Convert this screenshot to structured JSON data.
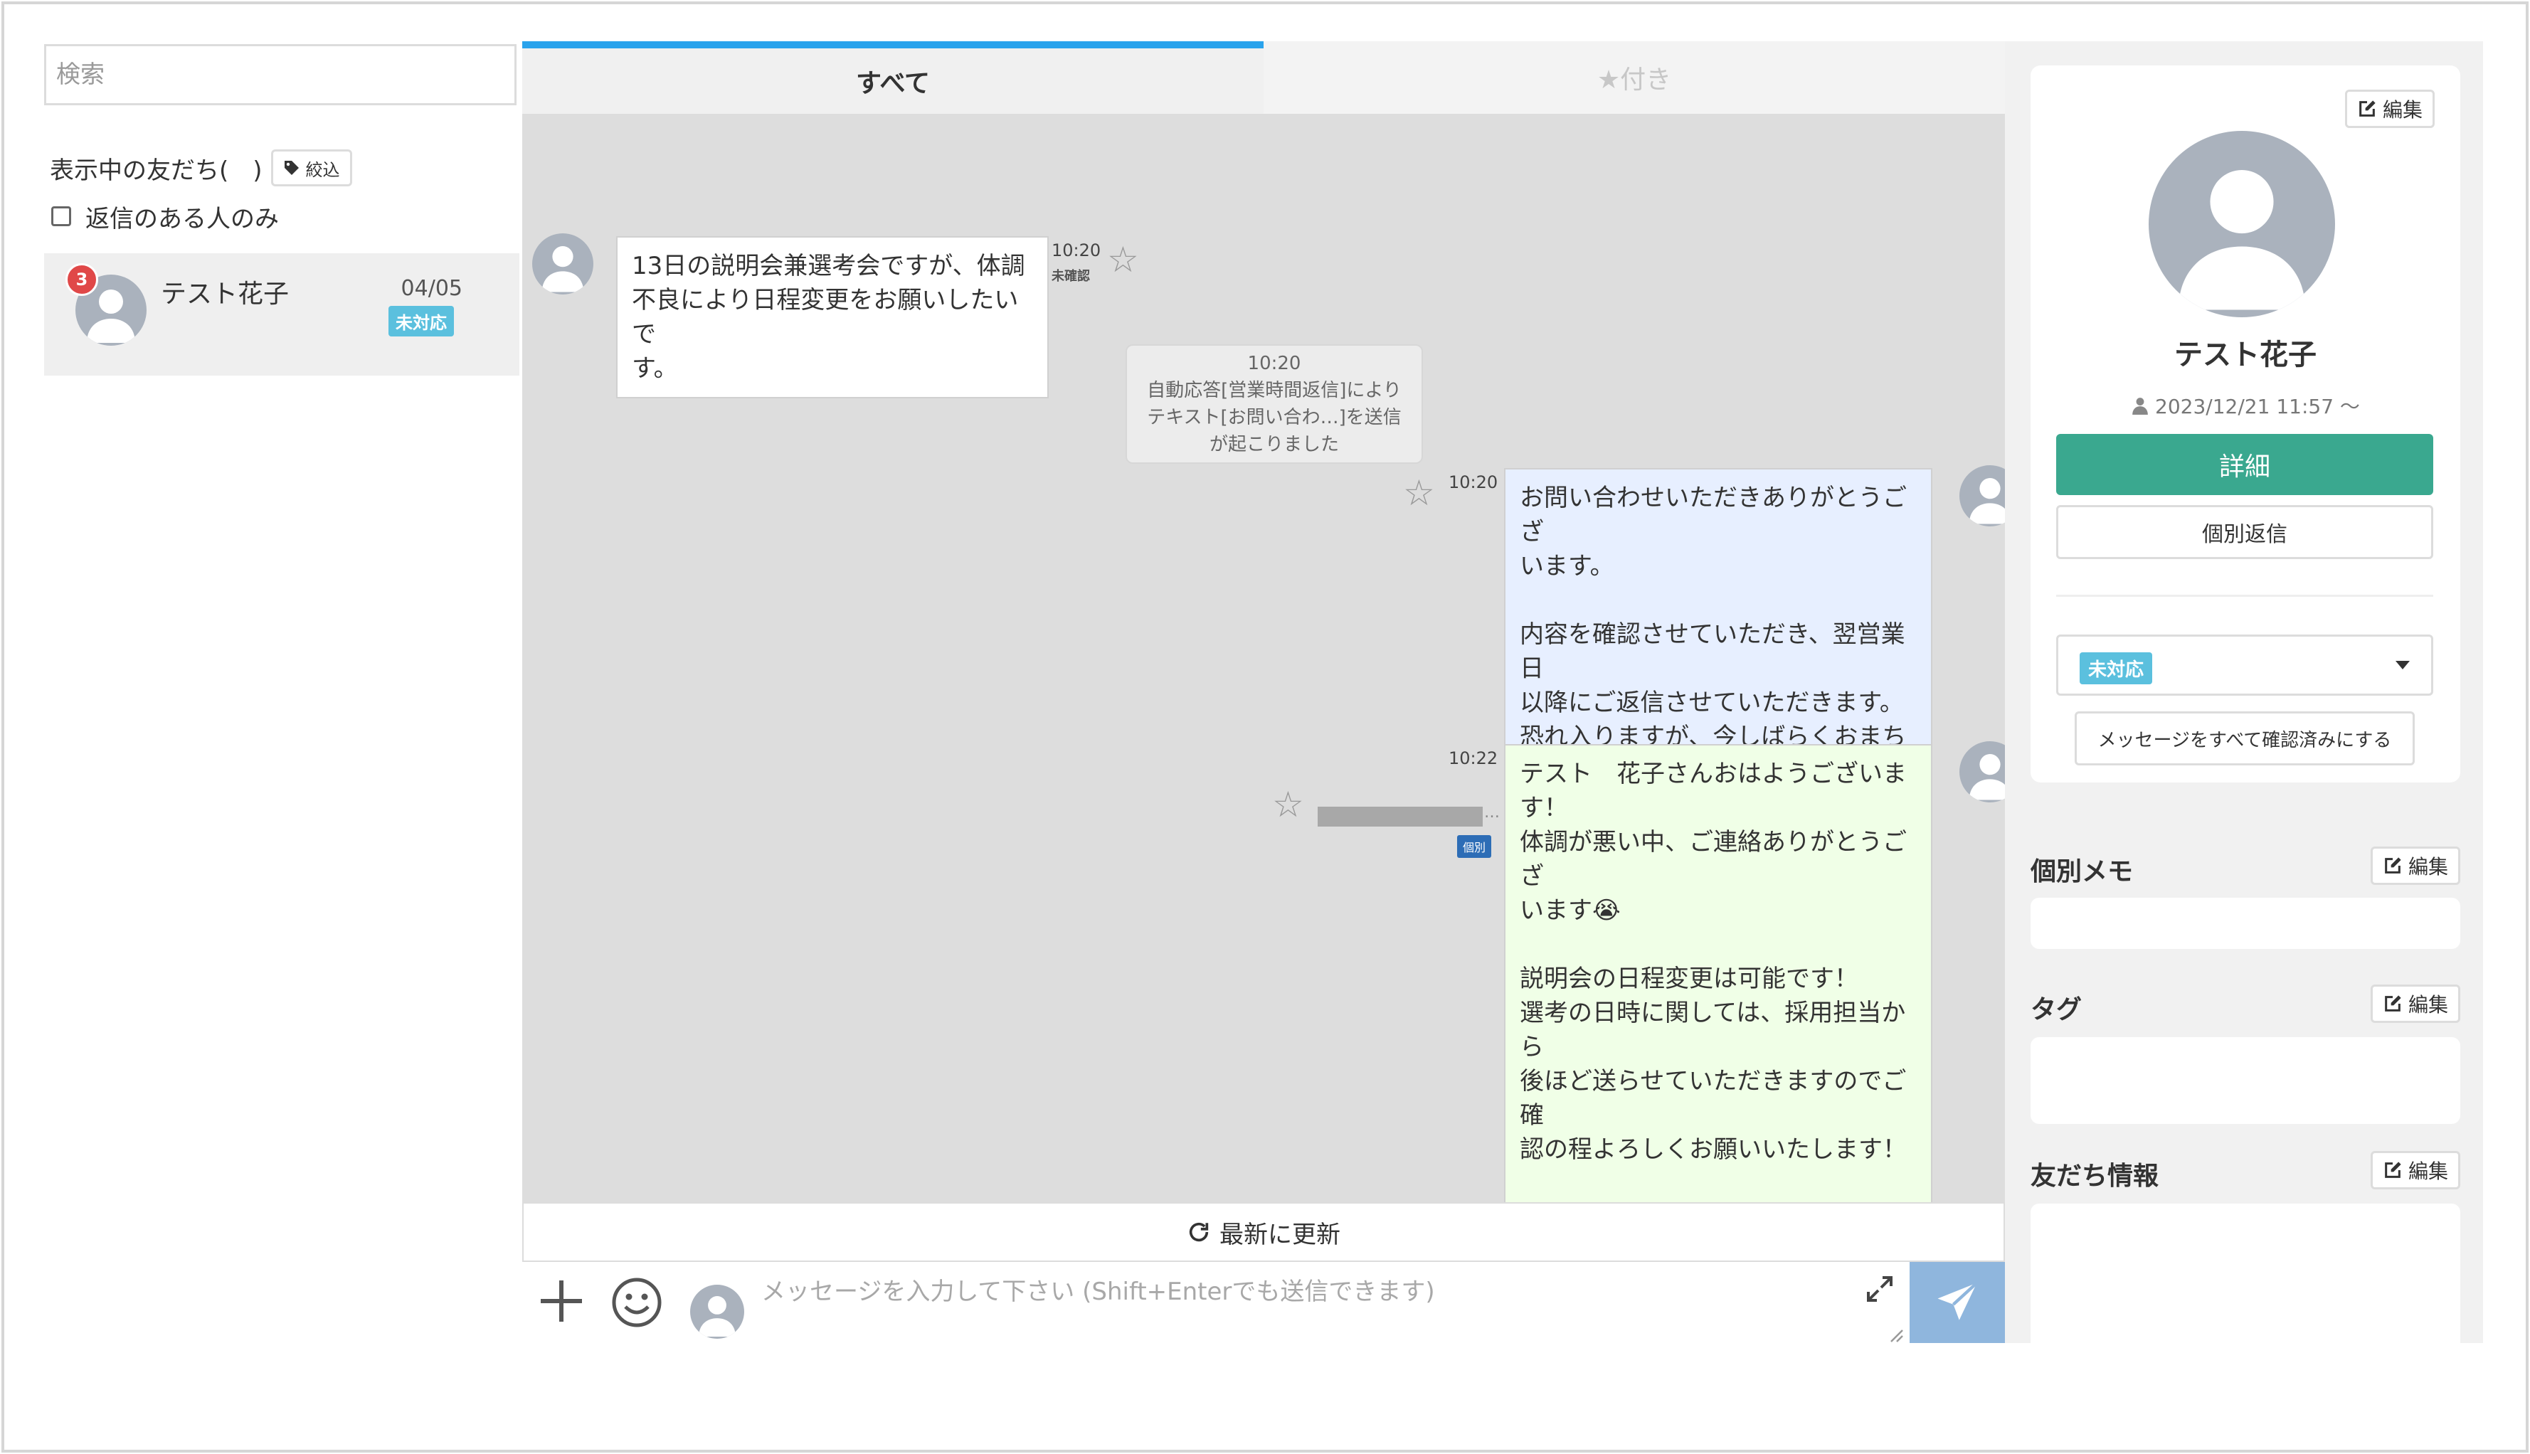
{
  "left": {
    "search_placeholder": "検索",
    "friends_label": "表示中の友だち(　)",
    "filter_button": "絞込",
    "reply_only_label": "返信のある人のみ",
    "friend": {
      "name": "テスト花子",
      "date": "04/05",
      "status": "未対応",
      "badge": "3"
    }
  },
  "tabs": {
    "all": "すべて",
    "starred": "★付き"
  },
  "messages": [
    {
      "text": "13日の説明会兼選考会ですが、体調\n不良により日程変更をお願いしたいで\nす。",
      "time": "10:20",
      "status": "未確認"
    },
    {
      "text": "お問い合わせいただきありがとうござ\nいます。\n\n内容を確認させていただき、翌営業日\n以降にご返信させていただきます。\n恐れ入りますが、今しばらくおまちく\nださい。",
      "time": "10:20"
    },
    {
      "text": "テスト　花子さんおはようございま\nす！\n体調が悪い中、ご連絡ありがとうござ\nいます😭\n\n説明会の日程変更は可能です！\n選考の日時に関しては、採用担当から\n後ほど送らせていただきますのでご確\n認の程よろしくお願いいたします！\n\n暑い日が続いてるので、水分を取って\nゆっくり休んでくださいね😢",
      "time": "10:22",
      "tag": "個別",
      "sender_dots": "…"
    }
  ],
  "system_message": {
    "time": "10:20",
    "text": "自動応答[営業時間返信]により\nテキスト[お問い合わ…]を送信\nが起こりました"
  },
  "refresh_label": "最新に更新",
  "input": {
    "placeholder": "メッセージを入力して下さい (Shift+Enterでも送信できます)"
  },
  "right": {
    "edit_label": "編集",
    "name": "テスト花子",
    "since": "2023/12/21 11:57 〜",
    "detail_button": "詳細",
    "individual_reply_button": "個別返信",
    "status_value": "未対応",
    "mark_all_read": "メッセージをすべて確認済みにする",
    "memo_title": "個別メモ",
    "tag_title": "タグ",
    "info_title": "友だち情報"
  },
  "colors": {
    "tab_active_border": "#2aa3ec",
    "detail_button": "#3aa88f",
    "status_badge": "#5bc0de",
    "unread_badge": "#e04848",
    "send_button": "#8fb6dd",
    "bubble_received": "#ffffff",
    "bubble_auto": "#e7efff",
    "bubble_sent": "#f0ffe7"
  },
  "icons": [
    "tag-icon",
    "user-icon",
    "edit-icon",
    "star-icon",
    "refresh-icon",
    "plus-icon",
    "smile-icon",
    "expand-icon",
    "send-icon",
    "caret-down-icon"
  ]
}
